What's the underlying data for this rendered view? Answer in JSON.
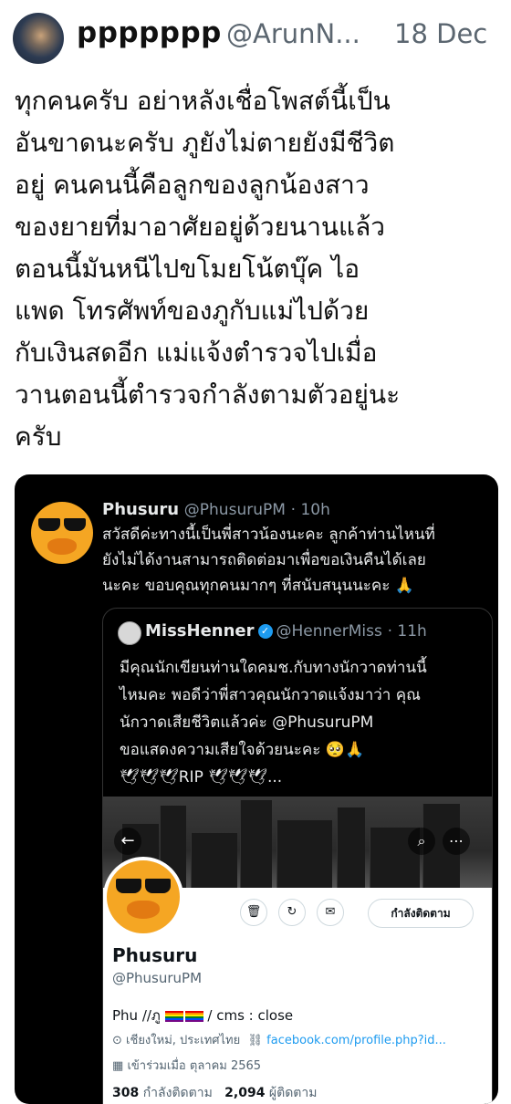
{
  "outer": {
    "name": "ppppppp",
    "handle": "@ArunN...",
    "date": "18 Dec",
    "text": "ทุกคนครับ อย่าหลังเชื่อโพสต์นี้เป็น\nอันขาดนะครับ ภูยังไม่ตายยังมีชีวิต\nอยู่ คนคนนี้คือลูกของลูกน้องสาว\nของยายที่มาอาศัยอยู่ด้วยนานแล้ว\nตอนนี้มันหนีไปขโมยโน้ตบุ๊ค ไอ\nแพด โทรศัพท์ของภูกับแม่ไปด้วย\nกับเงินสดอีก แม่แจ้งตำรวจไปเมื่อ\nวานตอนนี้ตำรวจกำลังตามตัวอยู่นะ\nครับ"
  },
  "embed": {
    "name": "Phusuru",
    "handle": "@PhusuruPM",
    "time": "· 10h",
    "text": "สวัสดีค่ะทางนี้เป็นพี่สาวน้องนะคะ ลูกค้าท่านไหนที่\nยังไม่ได้งานสามารถติดต่อมาเพื่อขอเงินคืนได้เลย\nนะคะ ขอบคุณทุกคนมากๆ ที่สนับสนุนนะคะ 🙏",
    "quote": {
      "name": "MissHenner",
      "verified": "✓",
      "handle": "@HennerMiss",
      "time": "· 11h",
      "text": "มีคุณนักเขียนท่านใดคมช.กับทางนักวาดท่านนี้\nไหมคะ พอดีว่าพี่สาวคุณนักวาดแจ้งมาว่า คุณ\nนักวาดเสียชีวิตแล้วค่ะ @PhusuruPM\nขอแสดงความเสียใจด้วยนะคะ 🥺🙏\n🕊🕊🕊RIP 🕊🕊🕊..."
    }
  },
  "profile": {
    "back_icon": "←",
    "search_icon": "⌕",
    "more_icon": "⋯",
    "action_icons": [
      "🗑",
      "↻",
      "✉"
    ],
    "follow_label": "กำลังติดตาม",
    "name": "Phusuru",
    "handle": "@PhusuruPM",
    "bio_prefix": "Phu //ภู",
    "bio_suffix": "/ cms : close",
    "location": "เชียงใหม่, ประเทศไทย",
    "link": "facebook.com/profile.php?id...",
    "joined": "เข้าร่วมเมื่อ ตุลาคม 2565",
    "following_count": "308",
    "following_label": "กำลังติดตาม",
    "followers_count": "2,094",
    "followers_label": "ผู้ติดตาม"
  }
}
